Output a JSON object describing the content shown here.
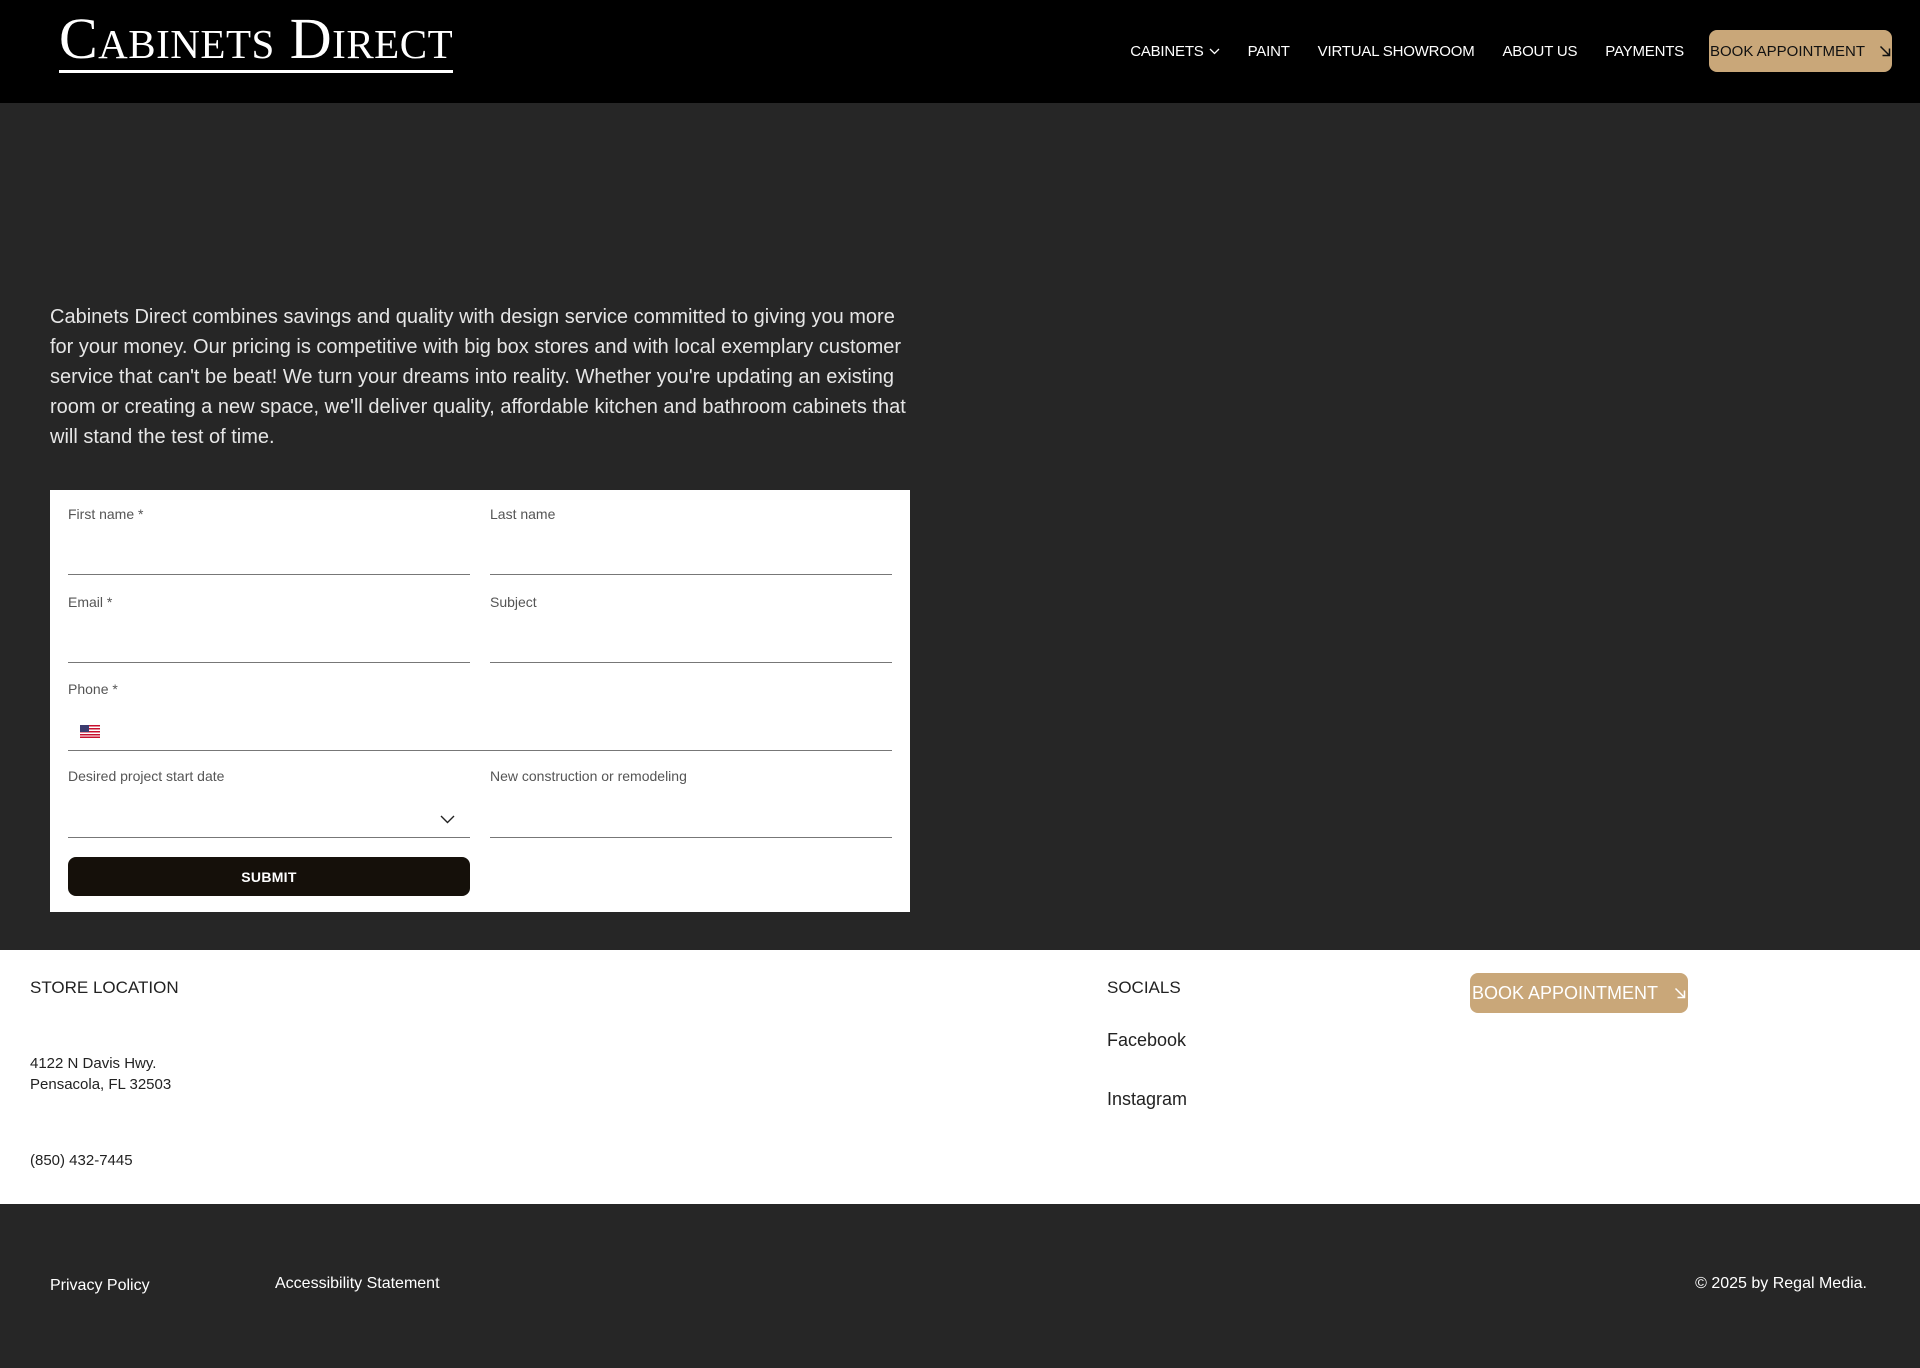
{
  "header": {
    "logo": "Cabinets Direct",
    "nav": [
      {
        "label": "CABINETS",
        "has_dropdown": true
      },
      {
        "label": "PAINT"
      },
      {
        "label": "VIRTUAL SHOWROOM"
      },
      {
        "label": "ABOUT US"
      },
      {
        "label": "PAYMENTS"
      }
    ],
    "book_label": "BOOK APPOINTMENT"
  },
  "intro": "Cabinets Direct combines savings and quality with design service committed to giving you more for your money. Our pricing is competitive with big box stores and with local exemplary customer service that can't be beat! We turn your dreams into reality. Whether you're updating an existing room or creating a new space, we'll deliver quality, affordable kitchen and bathroom cabinets that will stand the test of time.",
  "form": {
    "first_name": {
      "label": "First name *",
      "value": ""
    },
    "last_name": {
      "label": "Last name",
      "value": ""
    },
    "email": {
      "label": "Email *",
      "value": ""
    },
    "subject": {
      "label": "Subject",
      "value": ""
    },
    "phone": {
      "label": "Phone *",
      "value": ""
    },
    "start_date": {
      "label": "Desired project start date",
      "value": ""
    },
    "construction": {
      "label": "New construction or remodeling",
      "value": ""
    },
    "submit_label": "SUBMIT"
  },
  "footer": {
    "store_heading": "STORE LOCATION",
    "address_line1": "4122 N Davis Hwy.",
    "address_line2": "Pensacola, FL 32503",
    "phone": "(850) 432-7445",
    "socials_heading": "SOCIALS",
    "facebook": "Facebook",
    "instagram": "Instagram",
    "book_label": "BOOK APPOINTMENT",
    "privacy": "Privacy Policy",
    "accessibility": "Accessibility Statement",
    "copyright": "© 2025 by Regal Media."
  },
  "colors": {
    "accent": "#c9a779",
    "header_bg": "#000000",
    "page_bg": "#262626",
    "submit_bg": "#15100a"
  },
  "icons": [
    "chevron-down-icon",
    "arrow-down-right-icon",
    "us-flag-icon"
  ]
}
